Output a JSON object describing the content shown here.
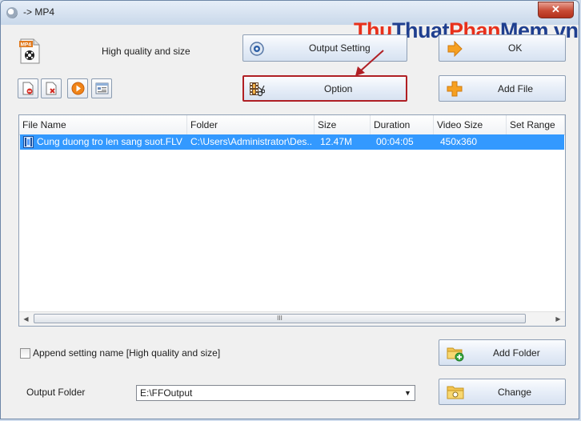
{
  "window": {
    "title": "-> MP4",
    "close_label": "✕"
  },
  "watermark": {
    "part1": "Thu",
    "part2": "Thuat",
    "part3": "Phan",
    "part4": "Mem.vn"
  },
  "profile": {
    "quality_text": "High quality and size",
    "icon": "mp4-video-icon"
  },
  "buttons": {
    "output_setting": "Output Setting",
    "ok": "OK",
    "option": "Option",
    "add_file": "Add File",
    "add_folder": "Add Folder",
    "change": "Change"
  },
  "toolbar_icons": [
    "remove-file-icon",
    "clear-list-icon",
    "play-icon",
    "media-info-icon"
  ],
  "file_list": {
    "columns": [
      "File Name",
      "Folder",
      "Size",
      "Duration",
      "Video Size",
      "Set Range"
    ],
    "rows": [
      {
        "file_name": "Cung duong tro len sang suot.FLV",
        "folder": "C:\\Users\\Administrator\\Des...",
        "size": "12.47M",
        "duration": "00:04:05",
        "video_size": "450x360",
        "set_range": ""
      }
    ],
    "scroll_grip": "III"
  },
  "append_setting": {
    "label": "Append setting name [High quality and size]",
    "checked": false
  },
  "output_folder": {
    "label": "Output Folder",
    "value": "E:\\FFOutput"
  },
  "colors": {
    "highlight": "#e8301b",
    "selection": "#3399ff",
    "annotation_box": "#b01f24"
  }
}
